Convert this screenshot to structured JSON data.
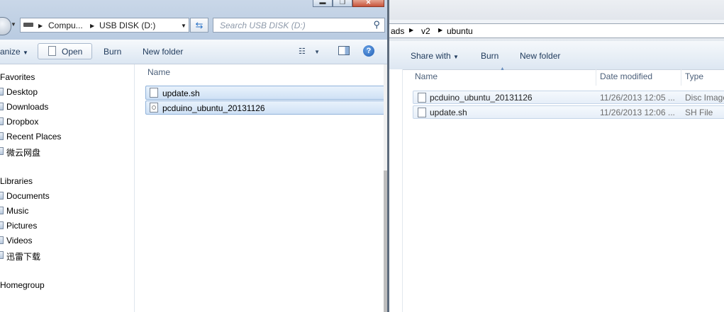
{
  "back_window": {
    "breadcrumb": [
      "ads",
      "v2",
      "ubuntu"
    ],
    "toolbar": {
      "share_with": "Share with",
      "burn": "Burn",
      "new_folder": "New folder"
    },
    "columns": {
      "name": "Name",
      "date_modified": "Date modified",
      "type": "Type"
    },
    "files": [
      {
        "name": "pcduino_ubuntu_20131126",
        "date": "11/26/2013 12:05 ...",
        "type": "Disc Image",
        "icon": "disc-image-icon"
      },
      {
        "name": "update.sh",
        "date": "11/26/2013 12:06 ...",
        "type": "SH File",
        "icon": "file-icon"
      }
    ]
  },
  "front_window": {
    "caption_buttons": {
      "minimize": "▬",
      "maximize": "❐",
      "close": "✕"
    },
    "address": {
      "part1": "Compu...",
      "part2": "USB DISK (D:)"
    },
    "search": {
      "placeholder": "Search USB DISK (D:)"
    },
    "toolbar": {
      "organize": "anize",
      "open": "Open",
      "burn": "Burn",
      "new_folder": "New folder"
    },
    "nav": {
      "favorites_header": "Favorites",
      "favorites": [
        "Desktop",
        "Downloads",
        "Dropbox",
        "Recent Places",
        "微云网盘"
      ],
      "libraries_header": "Libraries",
      "libraries": [
        "Documents",
        "Music",
        "Pictures",
        "Videos",
        "迅雷下载"
      ],
      "homegroup": "Homegroup"
    },
    "column_name": "Name",
    "files": [
      {
        "name": "update.sh",
        "icon": "file-icon"
      },
      {
        "name": "pcduino_ubuntu_20131126",
        "icon": "disc-image-icon"
      }
    ]
  }
}
